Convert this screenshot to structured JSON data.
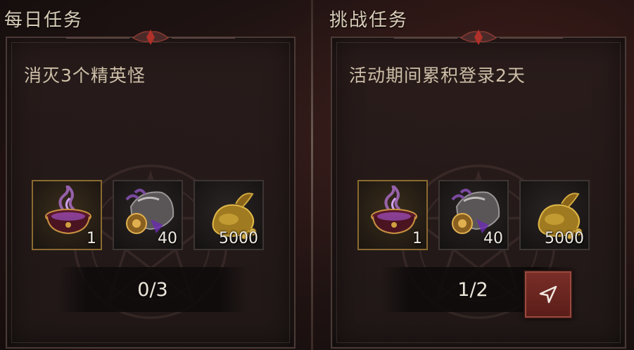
{
  "daily": {
    "header": "每日任务",
    "task_title": "消灭3个精英怪",
    "rewards": [
      {
        "icon": "cauldron-icon",
        "count": "1"
      },
      {
        "icon": "armor-icon",
        "count": "40"
      },
      {
        "icon": "gold-bag-icon",
        "count": "5000"
      }
    ],
    "progress": "0/3"
  },
  "challenge": {
    "header": "挑战任务",
    "task_title": "活动期间累积登录2天",
    "rewards": [
      {
        "icon": "cauldron-icon",
        "count": "1"
      },
      {
        "icon": "armor-icon",
        "count": "40"
      },
      {
        "icon": "gold-bag-icon",
        "count": "5000"
      }
    ],
    "progress": "1/2",
    "navigate_icon": "navigate-arrow-icon"
  },
  "colors": {
    "accent_red": "#7a2e28",
    "text_light": "#d8cdb8",
    "gold_border": "#8a6a30"
  }
}
